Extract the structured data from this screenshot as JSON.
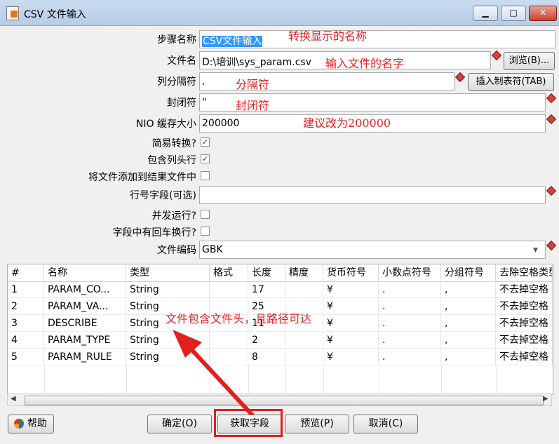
{
  "window": {
    "title": "CSV 文件输入",
    "minimize": "▁",
    "maximize": "□",
    "close": "✕"
  },
  "form": {
    "step_name": {
      "label": "步骤名称",
      "value": "CSV文件输入"
    },
    "filename": {
      "label": "文件名",
      "value": "D:\\培训\\sys_param.csv",
      "browse": "浏览(B)..."
    },
    "delimiter": {
      "label": "列分隔符",
      "value": ",",
      "insert_tab": "插入制表符(TAB)"
    },
    "enclosure": {
      "label": "封闭符",
      "value": "\""
    },
    "nio_buffer": {
      "label": "NIO 缓存大小",
      "value": "200000"
    },
    "lazy_conversion": {
      "label": "简易转换?",
      "checked": true
    },
    "header_row": {
      "label": "包含列头行",
      "checked": true
    },
    "add_filename": {
      "label": "将文件添加到结果文件中",
      "checked": false
    },
    "row_number_field": {
      "label": "行号字段(可选)",
      "value": ""
    },
    "parallel": {
      "label": "并发运行?",
      "checked": false
    },
    "newlines_in_fields": {
      "label": "字段中有回车换行?",
      "checked": false
    },
    "encoding": {
      "label": "文件编码",
      "value": "GBK"
    }
  },
  "annotations": {
    "step_name": "转换显示的名称",
    "filename": "输入文件的名字",
    "delimiter": "分隔符",
    "enclosure": "封闭符",
    "nio": "建议改为200000",
    "table": "文件包含文件头，且路径可达"
  },
  "table": {
    "columns": [
      "#",
      "名称",
      "类型",
      "格式",
      "长度",
      "精度",
      "货币符号",
      "小数点符号",
      "分组符号",
      "去除空格类型"
    ],
    "rows": [
      [
        "1",
        "PARAM_CO...",
        "String",
        "",
        "17",
        "",
        "¥",
        ".",
        ",",
        "不去掉空格"
      ],
      [
        "2",
        "PARAM_VA...",
        "String",
        "",
        "25",
        "",
        "¥",
        ".",
        ",",
        "不去掉空格"
      ],
      [
        "3",
        "DESCRIBE",
        "String",
        "",
        "11",
        "",
        "¥",
        ".",
        ",",
        "不去掉空格"
      ],
      [
        "4",
        "PARAM_TYPE",
        "String",
        "",
        "2",
        "",
        "¥",
        ".",
        ",",
        "不去掉空格"
      ],
      [
        "5",
        "PARAM_RULE",
        "String",
        "",
        "8",
        "",
        "¥",
        ".",
        ",",
        "不去掉空格"
      ]
    ]
  },
  "buttons": {
    "help": "帮助",
    "ok": "确定(O)",
    "get_fields": "获取字段",
    "preview": "预览(P)",
    "cancel": "取消(C)"
  },
  "colors": {
    "annotation": "#e0201e",
    "selection": "#3399ff"
  }
}
